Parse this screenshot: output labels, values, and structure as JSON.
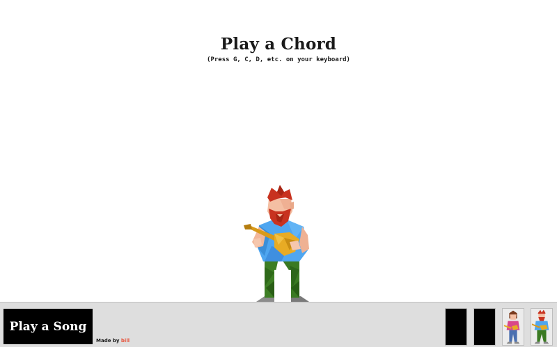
{
  "header": {
    "title": "Play a Chord",
    "subtitle": "(Press G, C, D, etc. on your keyboard)"
  },
  "character": {
    "icon": "bearded-guitarist-icon",
    "colors": {
      "hair": "#c8321f",
      "skin": "#f4bfa3",
      "shirt": "#4fa6f0",
      "pants": "#3a7a22",
      "guitar": "#e5a822",
      "shoes": "#8a8a8a"
    }
  },
  "footer": {
    "song_button_label": "Play a Song",
    "credit_prefix": "Made by ",
    "credit_author": "bill",
    "credit_author_color": "#e8523a",
    "thumbnails": [
      {
        "icon": "blank-slot-icon"
      },
      {
        "icon": "blank-slot-icon"
      },
      {
        "icon": "female-guitarist-icon"
      },
      {
        "icon": "bearded-guitarist-icon"
      }
    ]
  }
}
